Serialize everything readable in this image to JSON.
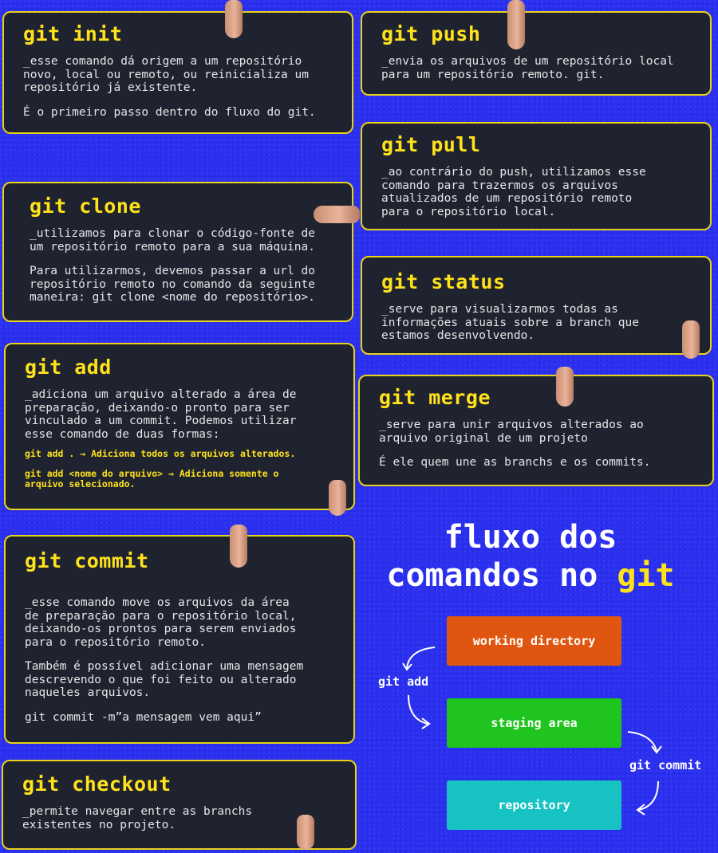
{
  "cards": {
    "init": {
      "title": "git init",
      "p1": "_esse comando dá origem a um repositório\nnovo, local ou remoto, ou reinicializa um\nrepositório já existente.",
      "p2": "É o primeiro passo dentro do fluxo do git."
    },
    "push": {
      "title": "git push",
      "p1": "_envia os arquivos de um repositório local\npara um repositório remoto. git."
    },
    "pull": {
      "title": "git pull",
      "p1": "_ao contrário do push, utilizamos esse\ncomando para trazermos os arquivos\natualizados de um repositório remoto\npara o repositório local."
    },
    "clone": {
      "title": "git clone",
      "p1": "_utilizamos para clonar o código-fonte de\num repositório remoto para a sua máquina.",
      "p2": "Para utilizarmos, devemos passar a url do\nrepositório remoto no comando da seguinte\nmaneira: git clone <nome do repositório>."
    },
    "status": {
      "title": "git status",
      "p1": "_serve para visualizarmos todas as\ninformações atuais sobre a branch que\nestamos desenvolvendo."
    },
    "add": {
      "title": "git add",
      "p1": "_adiciona um arquivo alterado a área de\npreparação, deixando-o pronto para ser\nvinculado a um commit. Podemos utilizar\nesse comando de duas formas:",
      "code1": "git add . → Adiciona todos os arquivos alterados.",
      "code2": "git add <nome do arquivo> → Adiciona somente o\narquivo selecionado."
    },
    "merge": {
      "title": "git merge",
      "p1": "_serve para unir arquivos alterados ao\narquivo original de um projeto",
      "p2": "É ele quem une as branchs e os commits."
    },
    "commit": {
      "title": "git commit",
      "p1": "_esse comando move os arquivos da área\nde preparação para o repositório local,\ndeixando-os prontos para serem enviados\npara o repositório remoto.",
      "p2": "Também é possível adicionar uma mensagem\ndescrevendo o que foi feito ou alterado\nnaqueles arquivos.",
      "p3": "git commit -m”a mensagem vem aqui”"
    },
    "checkout": {
      "title": "git checkout",
      "p1": "_permite navegar entre as branchs\nexistentes no projeto."
    }
  },
  "flow": {
    "title_line1": "fluxo dos",
    "title_line2_pre": "comandos no ",
    "title_line2_hl": "git",
    "working_directory": "working directory",
    "staging_area": "staging area",
    "repository": "repository",
    "label_add": "git add",
    "label_commit": "git commit",
    "colors": {
      "working_directory": "#e0550f",
      "staging_area": "#1fc41f",
      "repository": "#16c2c2",
      "accent": "#ffe21a",
      "card_bg": "#1f2330",
      "background": "#2a2ff0"
    }
  }
}
